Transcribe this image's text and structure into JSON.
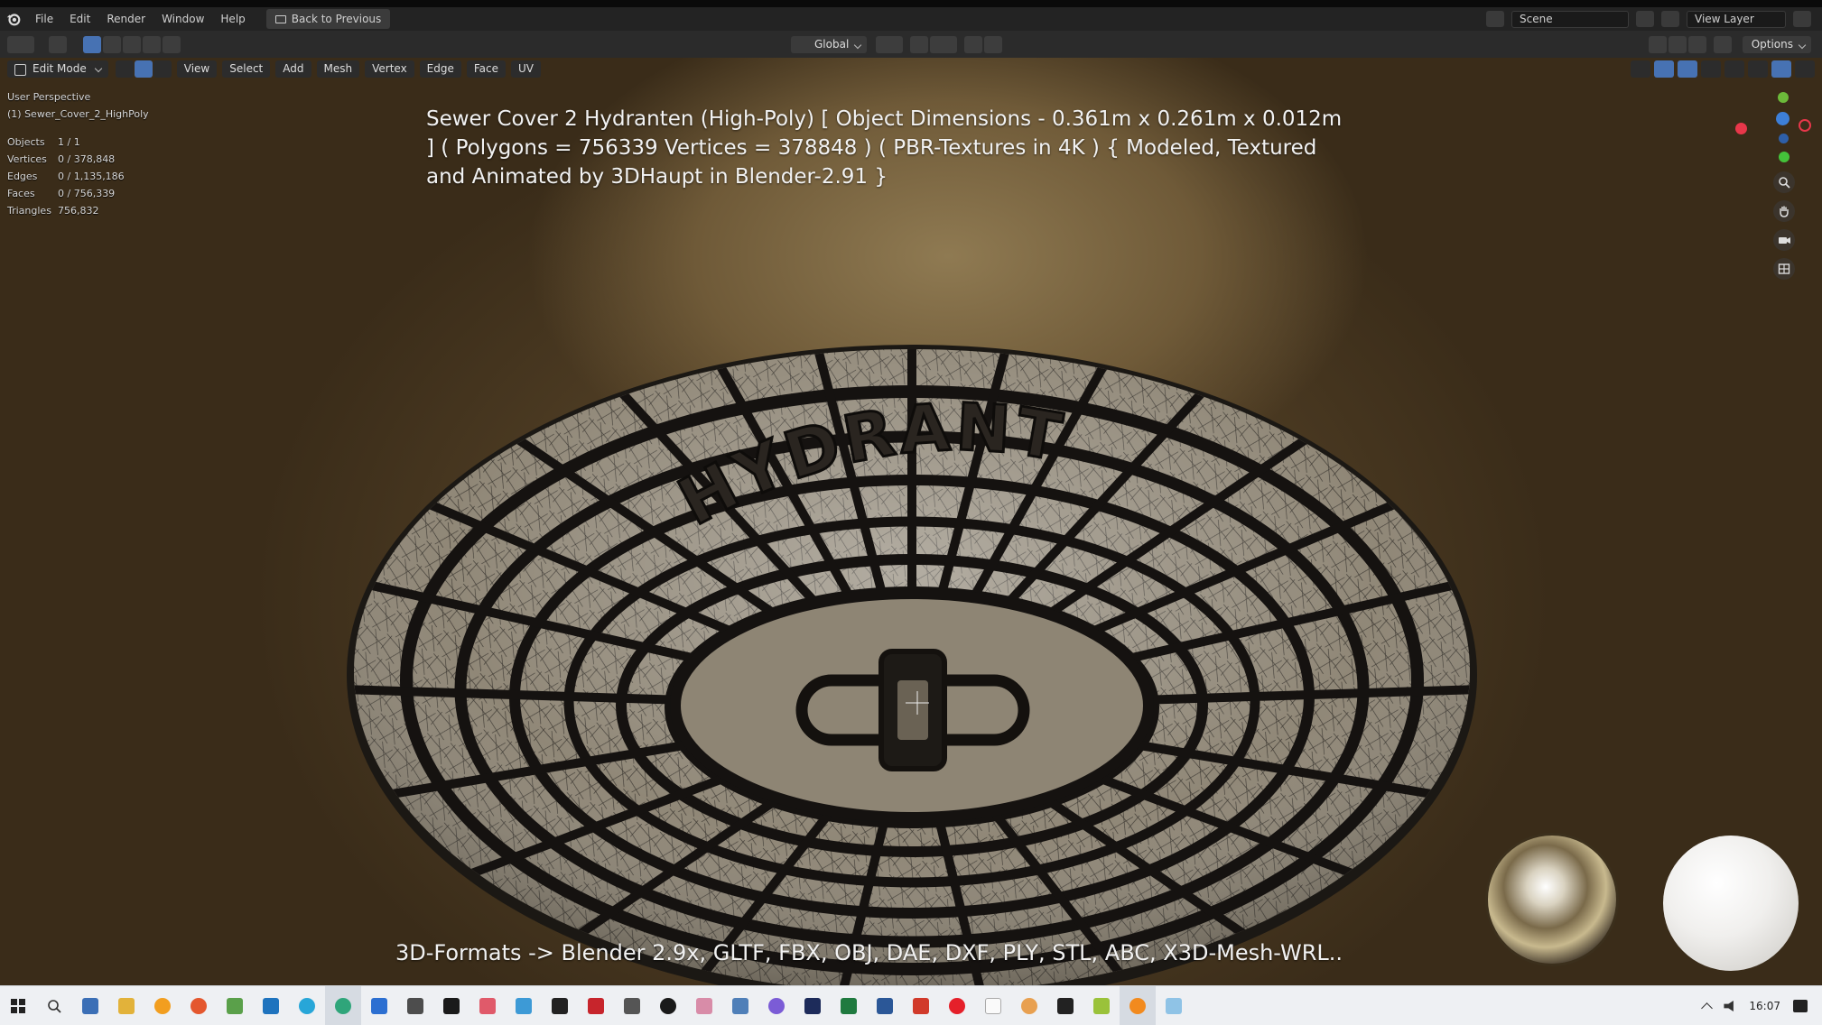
{
  "menubar": {
    "items": [
      "File",
      "Edit",
      "Render",
      "Window",
      "Help"
    ],
    "back_button": "Back to Previous",
    "scene": "Scene",
    "view_layer": "View Layer"
  },
  "header": {
    "transform_orientation": "Global",
    "options": "Options"
  },
  "viewport": {
    "mode": "Edit Mode",
    "menus": [
      "View",
      "Select",
      "Add",
      "Mesh",
      "Vertex",
      "Edge",
      "Face",
      "UV"
    ],
    "perspective": "User Perspective",
    "object_name": "(1) Sewer_Cover_2_HighPoly",
    "stats": [
      {
        "label": "Objects",
        "value": "1 / 1"
      },
      {
        "label": "Vertices",
        "value": "0 / 378,848"
      },
      {
        "label": "Edges",
        "value": "0 / 1,135,186"
      },
      {
        "label": "Faces",
        "value": "0 / 756,339"
      },
      {
        "label": "Triangles",
        "value": "756,832"
      }
    ],
    "model_text": "HYDRANT",
    "caption_top": "Sewer Cover 2 Hydranten (High-Poly) [ Object Dimensions -  0.361m x 0.261m x 0.012m ] ( Polygons = 756339 Vertices = 378848 ) ( PBR-Textures in 4K ) { Modeled, Textured and Animated by 3DHaupt in Blender-2.91 }",
    "caption_bottom": "3D-Formats -> Blender 2.9x, GLTF, FBX, OBJ, DAE, DXF, PLY, STL, ABC, X3D-Mesh-WRL.."
  },
  "taskbar": {
    "clock": "16:07"
  },
  "colors": {
    "menubar_bg": "#232323",
    "header_bg": "#2b2b2b",
    "accent_blue": "#4772b3",
    "axis_x": "#e8374a",
    "axis_y": "#6cba3a",
    "axis_z": "#3d7fd8"
  }
}
